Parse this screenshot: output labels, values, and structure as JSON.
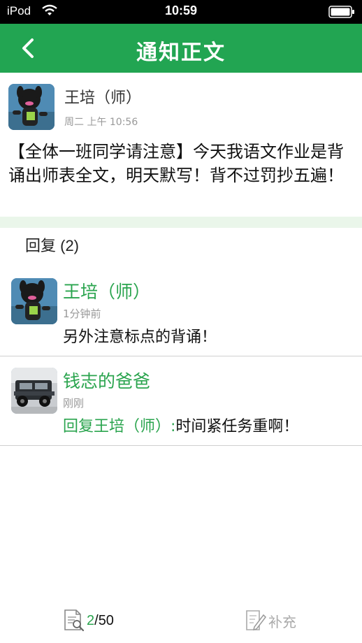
{
  "status_bar": {
    "carrier": "iPod",
    "time": "10:59"
  },
  "nav": {
    "title": "通知正文"
  },
  "post": {
    "author": "王培（师）",
    "time": "周二 上午 10:56",
    "body": "【全体一班同学请注意】今天我语文作业是背诵出师表全文，明天默写！背不过罚抄五遍！"
  },
  "replies": {
    "header": "回复 (2)",
    "items": [
      {
        "name": "王培（师）",
        "time": "1分钟前",
        "text": "另外注意标点的背诵！",
        "reply_to": ""
      },
      {
        "name": "钱志的爸爸",
        "time": "刚刚",
        "text": "时间紧任务重啊！",
        "reply_to": "回复王培（师）:"
      }
    ]
  },
  "bottom_bar": {
    "read": "2",
    "separator": "/",
    "total": "50",
    "supplement_label": "补充"
  },
  "colors": {
    "accent": "#22a552",
    "name_green": "#2aa44e",
    "band": "#eaf6ea"
  }
}
